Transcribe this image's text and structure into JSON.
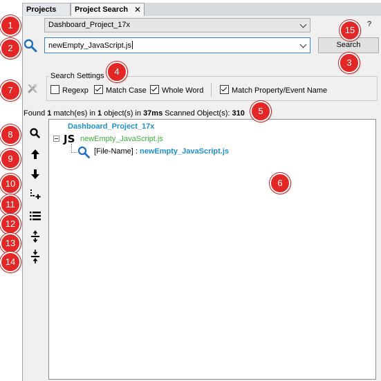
{
  "tabs": [
    {
      "label": "Projects"
    },
    {
      "label": "Project Search",
      "close": "✕"
    }
  ],
  "project_select": {
    "value": "Dashboard_Project_17x"
  },
  "help_label": "?",
  "search": {
    "value": "newEmpty_JavaScript.js",
    "button_label": "Search"
  },
  "settings": {
    "title": "Search Settings",
    "options": [
      {
        "label": "Regexp",
        "checked": false
      },
      {
        "label": "Match Case",
        "checked": true
      },
      {
        "label": "Whole Word",
        "checked": true
      },
      {
        "label": "Match Property/Event Name",
        "checked": true
      }
    ]
  },
  "status": {
    "prefix": "Found ",
    "matches": "1",
    "mid1": " match(es) in ",
    "objects": "1",
    "mid2": " object(s) in ",
    "time": "37ms",
    "mid3": " Scanned Object(s): ",
    "scanned": "310"
  },
  "tree": {
    "project": "Dashboard_Project_17x",
    "js_label": "JS",
    "file": "newEmpty_JavaScript.js",
    "leaf_prefix": "[File-Name] : ",
    "leaf_match": "newEmpty_JavaScript.js"
  },
  "toolbar_icons": [
    "search-icon",
    "arrow-up-icon",
    "arrow-down-icon",
    "expand-node-icon",
    "list-icon",
    "expand-all-icon",
    "collapse-all-icon"
  ],
  "callouts": [
    "1",
    "2",
    "3",
    "4",
    "5",
    "6",
    "7",
    "8",
    "9",
    "10",
    "11",
    "12",
    "13",
    "14",
    "15"
  ],
  "colors": {
    "callout": "#e32626",
    "link_blue": "#1e90c8",
    "file_green": "#3cae3c"
  }
}
